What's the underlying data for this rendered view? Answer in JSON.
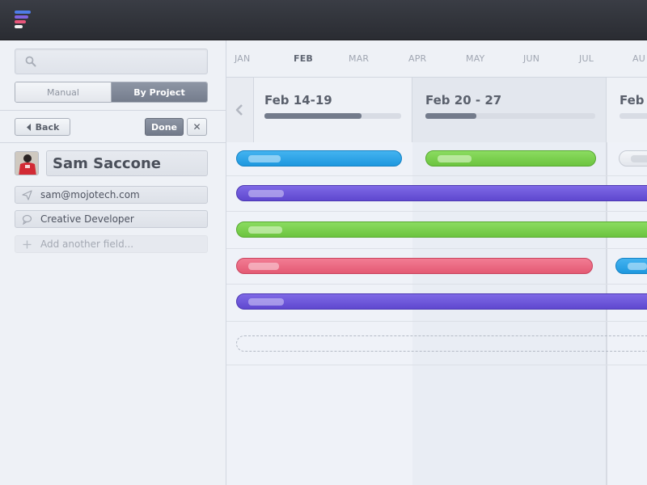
{
  "colors": {
    "blue": "#2aa3e8",
    "green": "#78cd4b",
    "purple": "#6852d8",
    "red": "#ea6780",
    "dark": "#2e3036"
  },
  "sidebar": {
    "search": {
      "placeholder": "",
      "value": ""
    },
    "segmented": {
      "manual": "Manual",
      "by_project": "By Project",
      "selected": "By Project"
    },
    "back_label": "Back",
    "done_label": "Done",
    "close_label": "✕",
    "profile": {
      "name": "Sam Saccone",
      "email": "sam@mojotech.com",
      "title": "Creative Developer",
      "add_field": "Add another field..."
    }
  },
  "timeline": {
    "months": [
      "JAN",
      "FEB",
      "MAR",
      "APR",
      "MAY",
      "JUN",
      "JUL",
      "AU"
    ],
    "active_month": "FEB",
    "weeks": [
      {
        "label": "Feb 14-19",
        "progress": 0.71
      },
      {
        "label": "Feb 20 - 27",
        "progress": 0.3
      },
      {
        "label": "Feb",
        "progress": 0.0
      }
    ]
  }
}
